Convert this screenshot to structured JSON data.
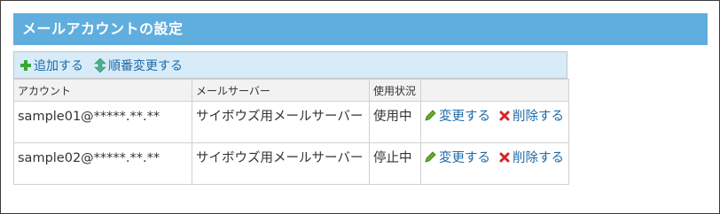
{
  "header": {
    "title": "メールアカウントの設定"
  },
  "toolbar": {
    "add_label": "追加する",
    "reorder_label": "順番変更する"
  },
  "table": {
    "columns": [
      "アカウント",
      "メールサーバー",
      "使用状況",
      ""
    ],
    "rows": [
      {
        "account": "sample01@*****.**.**",
        "server": "サイボウズ用メールサーバー",
        "status": "使用中",
        "status_type": "active",
        "edit_label": "変更する",
        "delete_label": "削除する"
      },
      {
        "account": "sample02@*****.**.**",
        "server": "サイボウズ用メールサーバー",
        "status": "停止中",
        "status_type": "stopped",
        "edit_label": "変更する",
        "delete_label": "削除する"
      }
    ]
  },
  "colors": {
    "header_bg": "#60aede",
    "toolbar_bg": "#d7ebf8",
    "link": "#1d6aa8",
    "active": "#228b22",
    "stopped": "#d62020"
  },
  "icons": {
    "add": "green-plus-icon",
    "reorder": "up-down-arrow-icon",
    "edit": "pencil-icon",
    "delete": "red-x-icon"
  }
}
